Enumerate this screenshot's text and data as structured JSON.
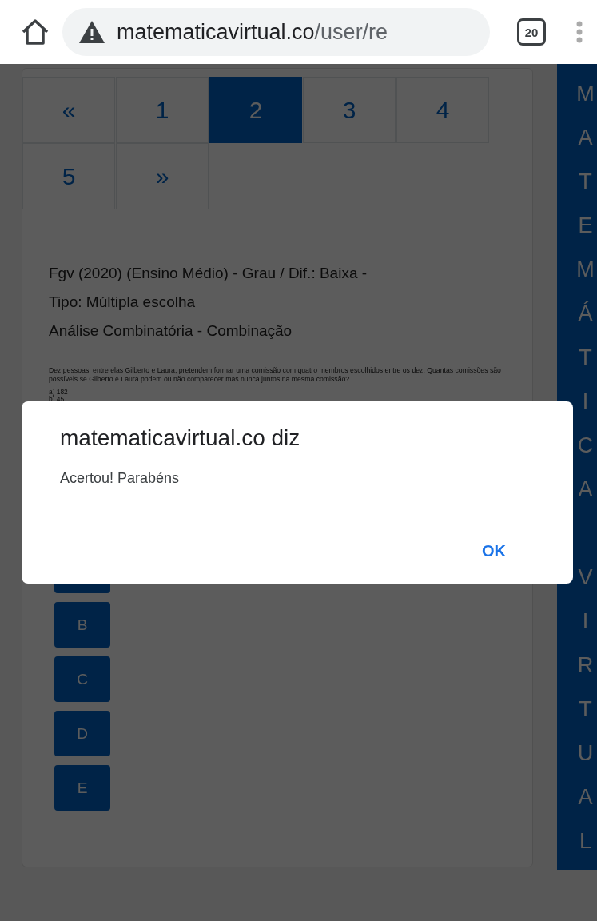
{
  "browser": {
    "host": "matematicavirtual.co",
    "path": "/user/re",
    "tab_count": "20"
  },
  "pagination": [
    {
      "label": "«",
      "selected": false
    },
    {
      "label": "1",
      "selected": false
    },
    {
      "label": "2",
      "selected": true
    },
    {
      "label": "3",
      "selected": false
    },
    {
      "label": "4",
      "selected": false
    },
    {
      "label": "5",
      "selected": false
    },
    {
      "label": "»",
      "selected": false
    }
  ],
  "question": {
    "header": [
      "Fgv (2020) (Ensino Médio) - Grau / Dif.: Baixa -",
      "Tipo: Múltipla escolha",
      "Análise Combinatória - Combinação"
    ],
    "text": "Dez pessoas, entre elas Gilberto e Laura, pretendem formar uma comissão com quatro membros escolhidos entre os dez. Quantas comissões são possíveis se Gilberto e Laura podem ou não comparecer mas nunca juntos na mesma comissão?",
    "options": [
      "a)  182",
      "b)  45"
    ]
  },
  "answers": [
    {
      "kind": "covered"
    },
    {
      "kind": "letter",
      "label": "B"
    },
    {
      "kind": "letter",
      "label": "C"
    },
    {
      "kind": "letter",
      "label": "D"
    },
    {
      "kind": "letter",
      "label": "E"
    }
  ],
  "sidebar_title": "MATEMÁTICA VIRTUAL",
  "dialog": {
    "title": "matematicavirtual.co diz",
    "message": "Acertou! Parabéns",
    "button": "OK"
  }
}
